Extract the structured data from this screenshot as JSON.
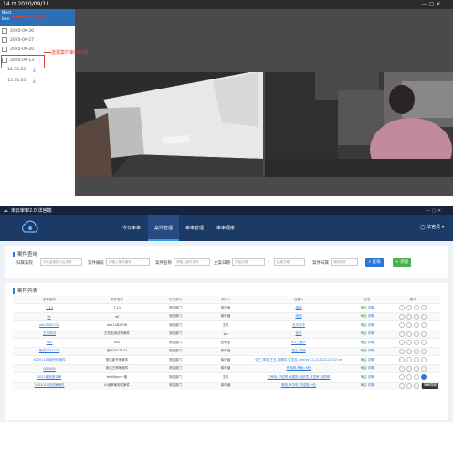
{
  "viewer": {
    "title": "14  ⊡ 2020/09/11",
    "window_controls": "—   ▢   ✕",
    "sidebar_header": {
      "line1": "Nest",
      "line2": "ban"
    },
    "dates": [
      "2020-09-30",
      "2020-09-27",
      "2020-09-20",
      "2020-09-13"
    ],
    "times": [
      "14:50:25",
      "15:30:35"
    ],
    "annotation_top": "双击播放",
    "annotation_select": "选择案件审前日期"
  },
  "app": {
    "title": "未云审审2.0 法官端",
    "window_controls": "—  ▢  ✕",
    "nav": [
      "今日审审",
      "案件管理",
      "审审管理",
      "审审观摩"
    ],
    "user": "◯ 法官员 ▾",
    "search": {
      "title": "案件查询",
      "fields": [
        {
          "label": "归属法院",
          "value": "河北省衡阳人民法院"
        },
        {
          "label": "案件编号",
          "value": "请输入案件编号"
        },
        {
          "label": "案件名称",
          "value": "请输入案件名称"
        },
        {
          "label": "立案日期",
          "value": "开始日期"
        },
        {
          "label": "",
          "value": "结束日期"
        },
        {
          "label": "案件归属",
          "value": "我的案件"
        }
      ],
      "search_btn": "查询",
      "add_btn": "添加"
    },
    "list": {
      "title": "案件列表",
      "columns": [
        "案件编号",
        "案件名称",
        "所在部门",
        "承办人",
        "当事人",
        "状态",
        "操作"
      ],
      "rows": [
        [
          "7.13",
          "7.13",
          "测试部门",
          "徐梓涵",
          "测测",
          "审结",
          "详情"
        ],
        [
          "fz",
          "wf",
          "测试部门",
          "徐梓涵",
          "测测",
          "审结",
          "详情"
        ],
        [
          "wfu1062706",
          "wfu1062706",
          "测试部门",
          "王机",
          "天冷冷冷",
          "审结",
          "详情"
        ],
        [
          "王机测试",
          "王机出测试审案件",
          "测试部门",
          "wh",
          "张总",
          "审结",
          "详情"
        ],
        [
          "002",
          "001",
          "测试部门",
          "杜审业",
          "9.1三案人",
          "审结",
          "详情"
        ],
        [
          "测试2021122",
          "测试2021122",
          "测试部门",
          "徐梓涵",
          "张三,李四",
          "审结",
          "详情"
        ],
        [
          "20201118新开审案件",
          "测试新开审案件",
          "测试部门",
          "徐梓涵",
          "张三,李四,王五,刘德华,张学友,wkshd 22,22222222222 ee",
          "审结",
          "详情"
        ],
        [
          "000000",
          "测试王审审案件",
          "测试部门",
          "徐梓涵",
          "外观测,审批,小杜",
          "审结",
          "详情"
        ],
        [
          "2021最新测试审",
          "testBbyn一案",
          "测试部门",
          "王机",
          "王审伟,付佳翔,黄建阳,张起灵,张显审,张丽明",
          "审结",
          "详情"
        ],
        [
          "2021010测试审案件",
          "小组审案测试案件",
          "测试部门",
          "徐梓涵",
          "测测,审中年,付佳翔,小杜",
          "审结",
          "详情"
        ]
      ],
      "tooltip": "审审视频"
    }
  }
}
